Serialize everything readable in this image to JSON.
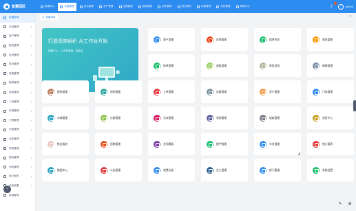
{
  "app": {
    "logo_text": "智慧园区"
  },
  "topnav": [
    {
      "label": "数据中心",
      "active": false
    },
    {
      "label": "运营管理",
      "active": true
    },
    {
      "label": "综合管理",
      "active": false
    },
    {
      "label": "资产管理",
      "active": false
    },
    {
      "label": "设备管理",
      "active": false
    },
    {
      "label": "能耗管理",
      "active": false
    },
    {
      "label": "安防管理",
      "active": false
    },
    {
      "label": "物业服务",
      "active": false
    },
    {
      "label": "招商管理",
      "active": false
    },
    {
      "label": "系统管理",
      "active": false
    },
    {
      "label": "帮助中心",
      "active": false
    }
  ],
  "header": {
    "bell_badge": "2",
    "user_name": "admin"
  },
  "sidebar": {
    "items": [
      {
        "label": "快捷菜单",
        "active": true,
        "arrow": ""
      },
      {
        "label": "日常管理",
        "active": false,
        "arrow": "∨"
      },
      {
        "label": "客户管理",
        "active": false,
        "arrow": "∨"
      },
      {
        "label": "租赁管理",
        "active": false,
        "arrow": "∨"
      },
      {
        "label": "合同管理",
        "active": false,
        "arrow": "∨"
      },
      {
        "label": "财务管理",
        "active": false,
        "arrow": "∨"
      },
      {
        "label": "收费管理",
        "active": false,
        "arrow": "∨"
      },
      {
        "label": "报修管理",
        "active": false,
        "arrow": "∨"
      },
      {
        "label": "巡检管理",
        "active": false,
        "arrow": "∨"
      },
      {
        "label": "工单管理",
        "active": false,
        "arrow": "∨"
      },
      {
        "label": "车辆管理",
        "active": false,
        "arrow": "∨"
      },
      {
        "label": "门禁管理",
        "active": false,
        "arrow": "∨"
      },
      {
        "label": "访客管理",
        "active": false,
        "arrow": "∨"
      },
      {
        "label": "仓库管理",
        "active": false,
        "arrow": "∨"
      },
      {
        "label": "采购管理",
        "active": false,
        "arrow": "∨"
      },
      {
        "label": "能耗管理",
        "active": false,
        "arrow": "∨"
      },
      {
        "label": "消息管理",
        "active": false,
        "arrow": "∨"
      },
      {
        "label": "统计报表",
        "active": false,
        "arrow": "∨"
      },
      {
        "label": "系统设置",
        "active": false,
        "arrow": "∨"
      },
      {
        "label": "权限管理",
        "active": false,
        "arrow": ""
      }
    ]
  },
  "tabs": [
    {
      "label": "快捷菜单"
    }
  ],
  "banner": {
    "title": "打造高效组织 从工作台开始",
    "subtitle": "快捷中心，工作更便捷、更高效"
  },
  "cards": [
    {
      "label": "客户管理",
      "color": "#2d8cf0"
    },
    {
      "label": "房源管理",
      "color": "#ed4014"
    },
    {
      "label": "租赁合同",
      "color": "#19be6b"
    },
    {
      "label": "收款管理",
      "color": "#ff9900"
    },
    {
      "label": "账单管理",
      "color": "#19be6b"
    },
    {
      "label": "退租管理",
      "color": "#9ccc65"
    },
    {
      "label": "审批流程",
      "color": "#b0b39a"
    },
    {
      "label": "催缴管理",
      "color": "#7a8ba8"
    },
    {
      "label": "报修管理",
      "color": "#b87b58"
    },
    {
      "label": "巡检管理",
      "color": "#26a69a"
    },
    {
      "label": "工单管理",
      "color": "#e5383b"
    },
    {
      "label": "设备管理",
      "color": "#78909c"
    },
    {
      "label": "资产管理",
      "color": "#f2994a"
    },
    {
      "label": "门禁管理",
      "color": "#2d8cf0"
    },
    {
      "label": "车辆管理",
      "color": "#2aa3c3"
    },
    {
      "label": "访客管理",
      "color": "#8bc34a"
    },
    {
      "label": "仓库管理",
      "color": "#d81b60"
    },
    {
      "label": "采购管理",
      "color": "#5c5f9e"
    },
    {
      "label": "能耗管理",
      "color": "#7e7788"
    },
    {
      "label": "消息中心",
      "color": "#c9a227"
    },
    {
      "label": "物业服务",
      "color": "#e8c6c0"
    },
    {
      "label": "招商管理",
      "color": "#e64a19"
    },
    {
      "label": "合同模板",
      "color": "#7b3fa8"
    },
    {
      "label": "楼宇管理",
      "color": "#19be6b"
    },
    {
      "label": "车位管理",
      "color": "#2d8cf0"
    },
    {
      "label": "统计报表",
      "color": "#e5383b"
    },
    {
      "label": "数据中心",
      "color": "#2aa3c3"
    },
    {
      "label": "公告管理",
      "color": "#e5383b"
    },
    {
      "label": "收费标准",
      "color": "#2d8cf0"
    },
    {
      "label": "员工管理",
      "color": "#2d5f8f"
    },
    {
      "label": "部门管理",
      "color": "#2d8cf0"
    },
    {
      "label": "系统设置",
      "color": "#19be6b"
    }
  ]
}
